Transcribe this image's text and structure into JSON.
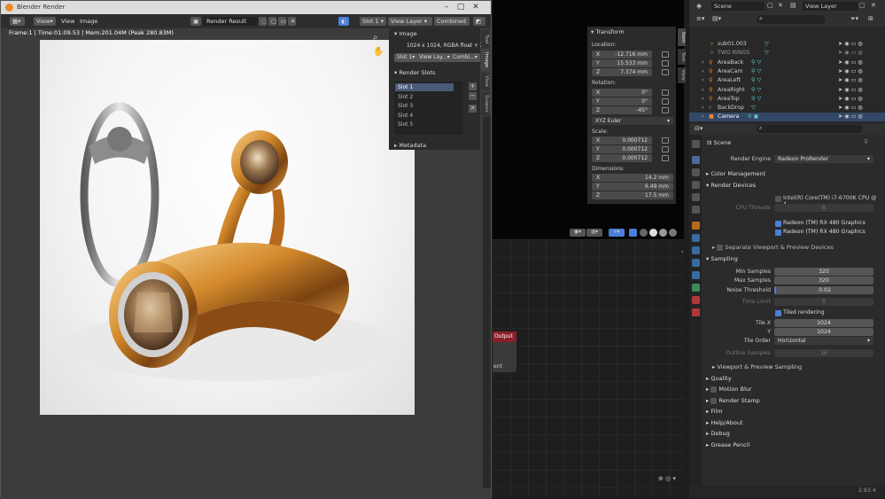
{
  "render_window": {
    "title": "Blender Render",
    "header": {
      "menu_view": "View",
      "menu_view2": "View",
      "menu_image": "Image",
      "image_name": "Render Result",
      "slot": "Slot 1",
      "view_layer": "View Layer",
      "pass": "Combined"
    },
    "frame_info": "Frame:1 | Time:01:09.53 | Mem:201.04M (Peak 280.83M)",
    "npanel": {
      "image_header": "Image",
      "image_info": "1024 x 1024,  RGBA float + Z",
      "slot_dd": "Slot 1",
      "viewlayer_dd": "View Lay...",
      "pass_dd": "Combi...",
      "render_slots_header": "Render Slots",
      "slots": [
        "Slot 1",
        "Slot 2",
        "Slot 3",
        "Slot 4",
        "Slot 5"
      ],
      "metadata_header": "Metadata",
      "tabs": [
        "Tool",
        "Image",
        "View",
        "Scopes"
      ]
    }
  },
  "viewport": {
    "transform_header": "Transform",
    "location_label": "Location:",
    "location": [
      {
        "axis": "X",
        "value": "-12.716 mm"
      },
      {
        "axis": "Y",
        "value": "15.533 mm"
      },
      {
        "axis": "Z",
        "value": "7.374 mm"
      }
    ],
    "rotation_label": "Rotation:",
    "rotation": [
      {
        "axis": "X",
        "value": "0°"
      },
      {
        "axis": "Y",
        "value": "0°"
      },
      {
        "axis": "Z",
        "value": "-45°"
      }
    ],
    "rotation_mode": "XYZ Euler",
    "scale_label": "Scale:",
    "scale": [
      {
        "axis": "X",
        "value": "0.000712"
      },
      {
        "axis": "Y",
        "value": "0.000712"
      },
      {
        "axis": "Z",
        "value": "0.000712"
      }
    ],
    "dimensions_label": "Dimensions:",
    "dimensions": [
      {
        "axis": "X",
        "value": "14.2 mm"
      },
      {
        "axis": "Y",
        "value": "6.49 mm"
      },
      {
        "axis": "Z",
        "value": "17.5 mm"
      }
    ],
    "tabs": [
      "Item",
      "Tool",
      "View"
    ]
  },
  "node_editor": {
    "output_node": "Output",
    "partial_label": "ent"
  },
  "outliner": {
    "scene": "Scene",
    "view_layer": "View Layer",
    "rows": [
      "sub01.003",
      "TWO RINGS",
      "AreaBack",
      "AreaCam",
      "AreaLeft",
      "AreaRight",
      "AreaTop",
      "BackDrop",
      "Camera"
    ]
  },
  "properties": {
    "scene_label": "Scene",
    "render_engine_label": "Render Engine",
    "render_engine": "Radeon ProRender",
    "color_management": "Color Management",
    "render_devices": "Render Devices",
    "cpu_device": "Intel(R) Core(TM) i7-6700K CPU @ 4...",
    "cpu_threads_label": "CPU Threads",
    "cpu_threads": "8",
    "gpu1": "Radeon (TM) RX 480 Graphics",
    "gpu2": "Radeon (TM) RX 480 Graphics",
    "separate_viewport": "Separate Viewport & Preview Devices",
    "sampling": "Sampling",
    "min_samples_label": "Min Samples",
    "min_samples": "320",
    "max_samples_label": "Max Samples",
    "max_samples": "320",
    "noise_threshold_label": "Noise Threshold",
    "noise_threshold": "0.02",
    "time_limit_label": "Time Limit",
    "time_limit": "0",
    "tiled_rendering": "Tiled rendering",
    "tile_x_label": "Tile X",
    "tile_x": "1024",
    "tile_y_label": "Y",
    "tile_y": "1024",
    "tile_order_label": "Tile Order",
    "tile_order": "Horizontal",
    "outline_samples_label": "Outline Samples",
    "outline_samples": "16",
    "viewport_sampling": "Viewport & Preview Sampling",
    "quality": "Quality",
    "motion_blur": "Motion Blur",
    "render_stamp": "Render Stamp",
    "film": "Film",
    "help_about": "Help/About",
    "debug": "Debug",
    "grease_pencil": "Grease Pencil",
    "version": "2.93.4"
  },
  "colors": {
    "accent_blue": "#4a7fd8",
    "output_node": "#8a1f2a",
    "gold": "#d48a2c"
  }
}
